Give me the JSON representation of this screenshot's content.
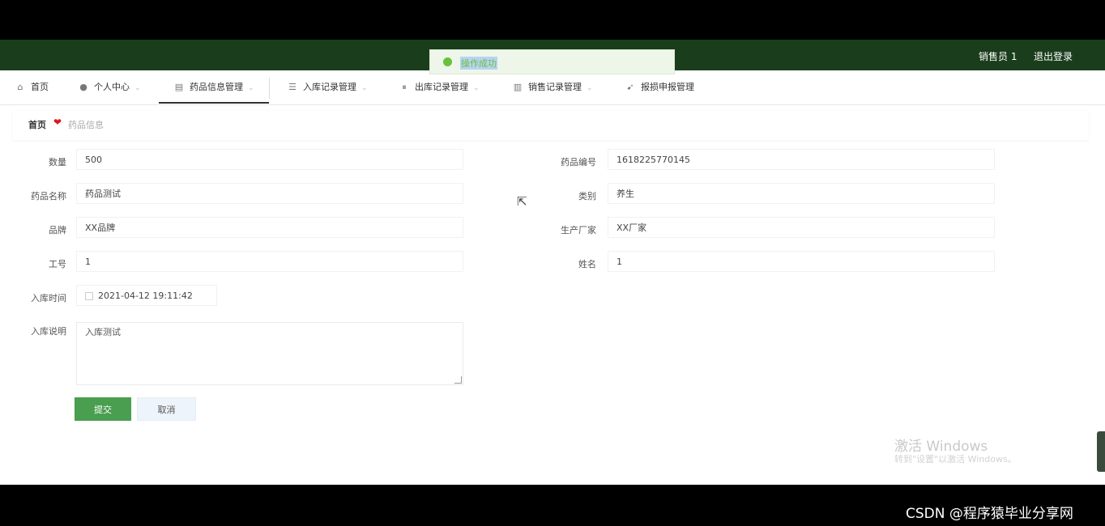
{
  "header": {
    "user": "销售员 1",
    "logout": "退出登录"
  },
  "toast": {
    "message": "操作成功"
  },
  "nav": {
    "items": [
      {
        "label": "首页",
        "icon": "home-icon"
      },
      {
        "label": "个人中心",
        "icon": "user-icon"
      },
      {
        "label": "药品信息管理",
        "icon": "pill-icon"
      },
      {
        "label": "入库记录管理",
        "icon": "list-icon"
      },
      {
        "label": "出库记录管理",
        "icon": "column-icon"
      },
      {
        "label": "销售记录管理",
        "icon": "chart-icon"
      },
      {
        "label": "报损申报管理",
        "icon": "flag-icon"
      }
    ]
  },
  "breadcrumb": {
    "home": "首页",
    "current": "药品信息"
  },
  "form": {
    "quantity_label": "数量",
    "quantity": "500",
    "code_label": "药品编号",
    "code": "1618225770145",
    "name_label": "药品名称",
    "name": "药品测试",
    "category_label": "类别",
    "category": "养生",
    "brand_label": "品牌",
    "brand": "XX品牌",
    "maker_label": "生产厂家",
    "maker": "XX厂家",
    "staff_id_label": "工号",
    "staff_id": "1",
    "staff_name_label": "姓名",
    "staff_name": "1",
    "time_label": "入库时间",
    "time": "2021-04-12 19:11:42",
    "detail_label": "入库说明",
    "detail": "入库测试",
    "submit": "提交",
    "cancel": "取消"
  },
  "watermark": {
    "line1": "激活 Windows",
    "line2": "转到\"设置\"以激活 Windows。"
  },
  "footer_watermark": "CSDN @程序猿毕业分享网",
  "colors": {
    "header_bg": "#1a3e1c",
    "primary": "#4a9e4f",
    "success_toast": "#67c23a",
    "heart": "#e0141e"
  }
}
